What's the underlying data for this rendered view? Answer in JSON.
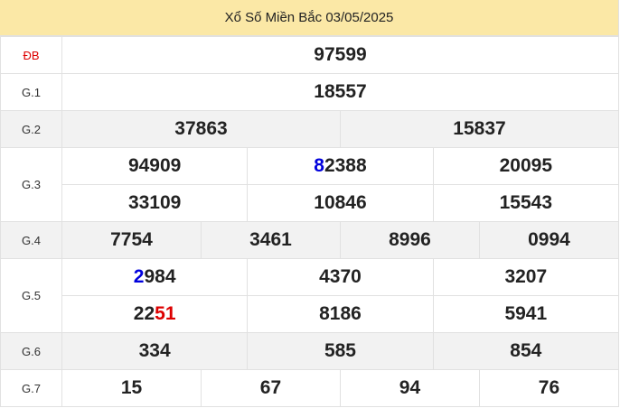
{
  "header": {
    "title": "Xổ Số Miền Bắc 03/05/2025"
  },
  "prizes": {
    "db": {
      "label": "ĐB",
      "values": [
        "97599"
      ]
    },
    "g1": {
      "label": "G.1",
      "values": [
        "18557"
      ]
    },
    "g2": {
      "label": "G.2",
      "values": [
        "37863",
        "15837"
      ]
    },
    "g3": {
      "label": "G.3",
      "values": [
        "94909",
        "82388",
        "20095",
        "33109",
        "10846",
        "15543"
      ]
    },
    "g4": {
      "label": "G.4",
      "values": [
        "7754",
        "3461",
        "8996",
        "0994"
      ]
    },
    "g5": {
      "label": "G.5",
      "values": [
        "2984",
        "4370",
        "3207",
        "2251",
        "8186",
        "5941"
      ]
    },
    "g6": {
      "label": "G.6",
      "values": [
        "334",
        "585",
        "854"
      ]
    },
    "g7": {
      "label": "G.7",
      "values": [
        "15",
        "67",
        "94",
        "76"
      ]
    }
  },
  "highlight_colors": {
    "blue": "#0000dd",
    "red": "#dd0000",
    "header_bg": "#fbe8a6"
  }
}
